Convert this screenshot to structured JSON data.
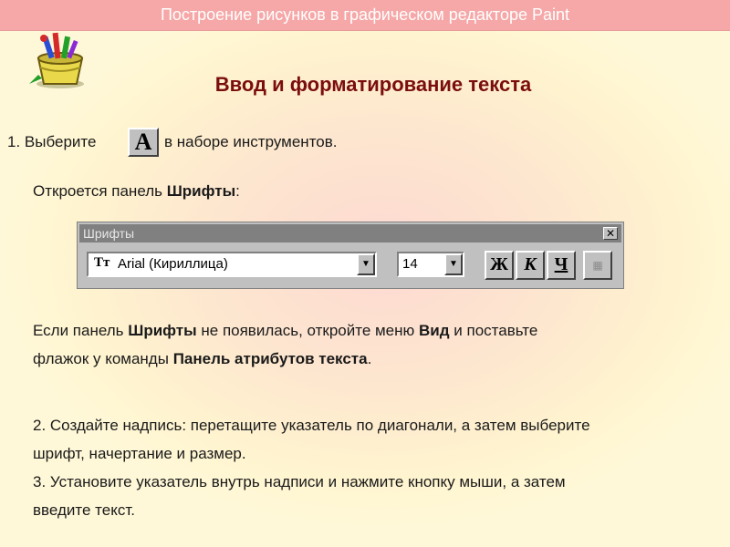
{
  "header": {
    "title": "Построение рисунков в графическом редакторе Paint"
  },
  "main_title": "Ввод и форматирование текста",
  "step1": {
    "before": "1. Выберите",
    "tool_letter": "A",
    "after": "в наборе инструментов."
  },
  "open_panel": {
    "prefix": "Откроется панель ",
    "bold": "Шрифты",
    "suffix": ":"
  },
  "fonts_toolbar": {
    "title": "Шрифты",
    "close_label": "✕",
    "font_icon": "Tт",
    "font_value": "Arial (Кириллица)",
    "size_value": "14",
    "bold_label": "Ж",
    "italic_label": "К",
    "underline_label": "Ч",
    "vertical_label": "▦",
    "dropdown_glyph": "▼"
  },
  "para1": {
    "t1": "Если панель ",
    "b1": "Шрифты",
    "t2": " не появилась, откройте меню ",
    "b2": "Вид",
    "t3": " и поставьте",
    "t4": "флажок у команды ",
    "b3": "Панель атрибутов текста",
    "t5": "."
  },
  "para2": {
    "line1": "2. Создайте надпись: перетащите указатель по диагонали, а затем выберите",
    "line2": "шрифт, начертание и размер."
  },
  "para3": {
    "line1": "3. Установите указатель внутрь надписи и нажмите кнопку мыши, а затем",
    "line2": "введите текст."
  },
  "icons": {
    "logo": "paint-bucket-brushes-icon"
  }
}
